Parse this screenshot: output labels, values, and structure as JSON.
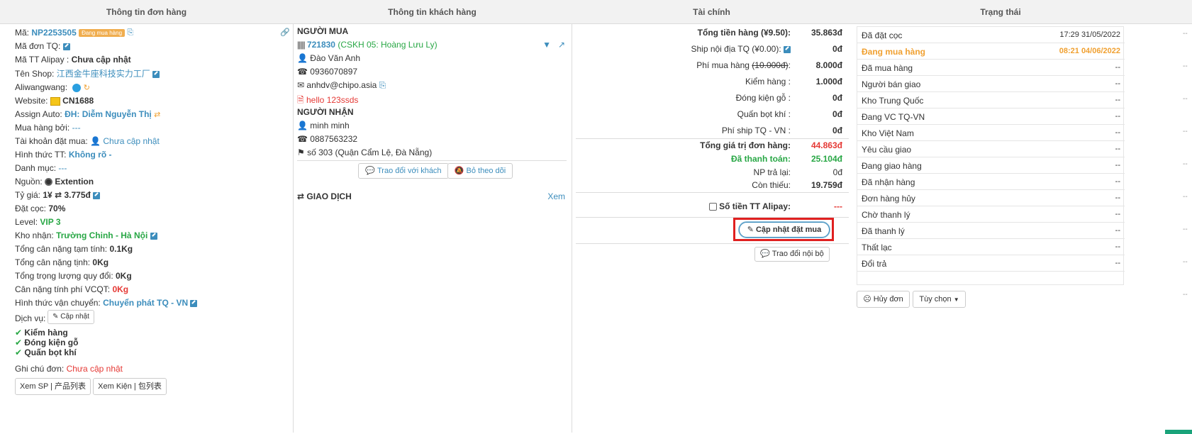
{
  "headers": {
    "order_info": "Thông tin đơn hàng",
    "customer_info": "Thông tin khách hàng",
    "finance": "Tài chính",
    "status": "Trạng thái"
  },
  "order": {
    "code_label": "Mã:",
    "code": "NP2253505",
    "badge": "Đang mua hàng",
    "tq_code_label": "Mã đơn TQ:",
    "alipay_label": "Mã TT Alipay :",
    "alipay_value": "Chưa cập nhật",
    "shop_label": "Tên Shop:",
    "shop_value": "江西金牛座科技实力工厂",
    "aliwangwang_label": "Aliwangwang:",
    "website_label": "Website:",
    "website_value": "CN1688",
    "assign_label": "Assign Auto:",
    "assign_value": "ĐH: Diễm Nguyễn Thị",
    "buyer_label": "Mua hàng bởi:",
    "buyer_value": "---",
    "account_label": "Tài khoản đặt mua:",
    "account_value": "Chưa cập nhật",
    "payment_label": "Hình thức TT:",
    "payment_value": "Không rõ -",
    "category_label": "Danh mục:",
    "category_value": "---",
    "source_label": "Nguồn:",
    "source_value": "Extention",
    "rate_label": "Tỷ giá:",
    "rate_left": "1¥",
    "rate_right": "3.775đ",
    "deposit_label": "Đặt cọc:",
    "deposit_value": "70%",
    "level_label": "Level:",
    "level_value": "VIP 3",
    "warehouse_label": "Kho nhận:",
    "warehouse_value": "Trường Chinh - Hà Nội",
    "est_weight_label": "Tổng cân nặng tạm tính:",
    "est_weight_value": "0.1Kg",
    "net_weight_label": "Tổng cân nặng tịnh:",
    "net_weight_value": "0Kg",
    "conv_weight_label": "Tổng trọng lượng quy đổi:",
    "conv_weight_value": "0Kg",
    "vcqt_weight_label": "Cân nặng tính phí VCQT:",
    "vcqt_weight_value": "0Kg",
    "ship_method_label": "Hình thức vận chuyển:",
    "ship_method_value": "Chuyển phát TQ - VN",
    "service_label": "Dịch vụ:",
    "service_button": "Cập nhật",
    "services": [
      "Kiểm hàng",
      "Đóng kiện gỗ",
      "Quấn bọt khí"
    ],
    "note_label": "Ghi chú đơn:",
    "note_value": "Chưa cập nhật",
    "view_sp_button": "Xem SP | 产品列表",
    "view_kien_button": "Xem Kiện | 包列表"
  },
  "customer": {
    "buyer_title": "NGƯỜI MUA",
    "buyer_id": "721830",
    "buyer_cskh": "(CSKH 05: Hoàng Lưu Ly)",
    "buyer_name": "Đào Văn Anh",
    "buyer_phone": "0936070897",
    "buyer_email": "anhdv@chipo.asia",
    "buyer_note": "hello 123ssds",
    "receiver_title": "NGƯỜI NHẬN",
    "receiver_name": "minh minh",
    "receiver_phone": "0887563232",
    "receiver_address": "số 303 (Quận Cẩm Lệ, Đà Nẵng)",
    "chat_button": "Trao đổi với khách",
    "unfollow_button": "Bỏ theo dõi",
    "transactions_title": "GIAO DỊCH",
    "transactions_view": "Xem"
  },
  "finance": {
    "rows": [
      {
        "label": "Tổng tiền hàng (¥9.50):",
        "value": "35.863đ",
        "bold": true
      },
      {
        "label": "Ship nội địa TQ (¥0.00):",
        "value": "0đ"
      },
      {
        "label": "Phí mua hàng",
        "strike": "(10.000đ)",
        "value": "8.000đ"
      },
      {
        "label": "Kiểm hàng :",
        "value": "1.000đ"
      },
      {
        "label": "Đóng kiện gỗ :",
        "value": "0đ"
      },
      {
        "label": "Quấn bọt khí :",
        "value": "0đ"
      },
      {
        "label": "Phí ship TQ - VN :",
        "value": "0đ"
      }
    ],
    "total_label": "Tổng giá trị đơn hàng:",
    "total_value": "44.863đ",
    "paid_label": "Đã thanh toán:",
    "paid_value": "25.104đ",
    "refund_label": "NP trả lại:",
    "refund_value": "0đ",
    "remaining_label": "Còn thiếu:",
    "remaining_value": "19.759đ",
    "alipay_label": "Số tiền TT Alipay:",
    "alipay_value": "---",
    "update_button": "Cập nhật đặt mua",
    "internal_chat_button": "Trao đổi nội bộ"
  },
  "status": {
    "rows": [
      {
        "name": "Đã đặt cọc",
        "time": "17:29 31/05/2022"
      },
      {
        "name": "Đang mua hàng",
        "time": "08:21 04/06/2022",
        "active": true
      },
      {
        "name": "Đã mua hàng",
        "time": "--"
      },
      {
        "name": "Người bán giao",
        "time": "--"
      },
      {
        "name": "Kho Trung Quốc",
        "time": "--"
      },
      {
        "name": "Đang VC TQ-VN",
        "time": "--"
      },
      {
        "name": "Kho Việt Nam",
        "time": "--"
      },
      {
        "name": "Yêu cầu giao",
        "time": "--"
      },
      {
        "name": "Đang giao hàng",
        "time": "--"
      },
      {
        "name": "Đã nhận hàng",
        "time": "--"
      },
      {
        "name": "Đơn hàng hủy",
        "time": "--"
      },
      {
        "name": "Chờ thanh lý",
        "time": "--"
      },
      {
        "name": "Đã thanh lý",
        "time": "--"
      },
      {
        "name": "Thất lạc",
        "time": "--"
      },
      {
        "name": "Đổi trả",
        "time": "--"
      }
    ],
    "cancel_button": "Hủy đơn",
    "options_button": "Tùy chọn"
  },
  "colors": {
    "accent": "#3c8dbc",
    "success": "#28a745",
    "danger": "#e53935",
    "warning": "#f0a030",
    "highlight_box": "#e02020"
  }
}
